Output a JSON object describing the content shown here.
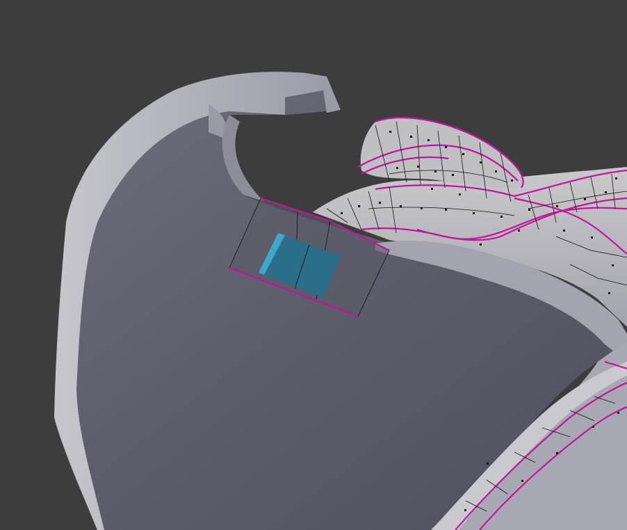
{
  "viewport": {
    "background": "#3d3d3d",
    "mode": "mesh-edit-3d-viewport",
    "colors": {
      "surface_light": "#b8b8c0",
      "surface_mid": "#8a8a96",
      "surface_shadow": "#6a6a78",
      "interior": "#5e5e6c",
      "selected_face": "#2a6e8a",
      "selected_face_edge": "#3fa8c6",
      "seam_edge": "#c0169c",
      "wire": "#111111"
    },
    "icons": [
      "selected-face-icon",
      "vertex-dot-icon"
    ]
  }
}
